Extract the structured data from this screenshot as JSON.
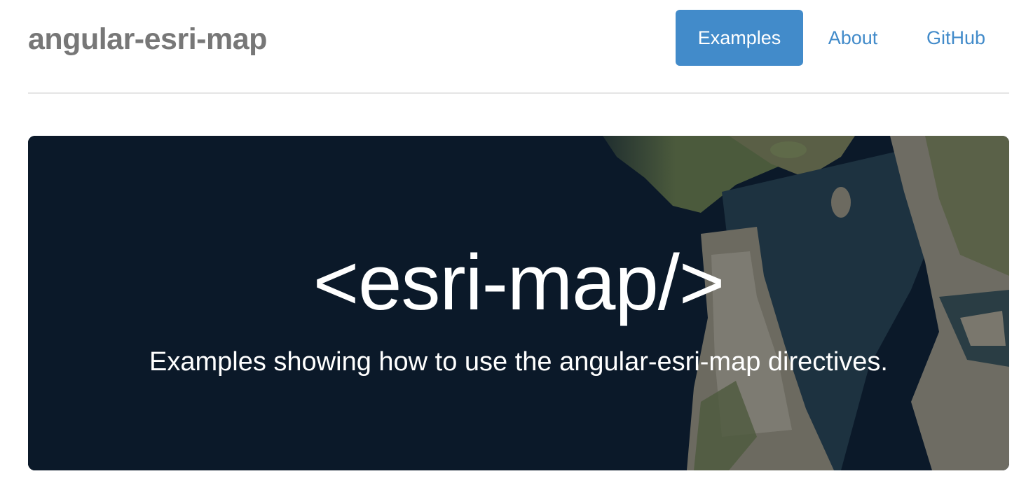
{
  "header": {
    "brand": "angular-esri-map",
    "nav": [
      {
        "label": "Examples",
        "active": true
      },
      {
        "label": "About",
        "active": false
      },
      {
        "label": "GitHub",
        "active": false
      }
    ]
  },
  "hero": {
    "title": "<esri-map/>",
    "subtitle": "Examples showing how to use the angular-esri-map directives."
  },
  "colors": {
    "accent": "#428bca",
    "brand_text": "#777777",
    "hero_bg": "#0b1929"
  }
}
